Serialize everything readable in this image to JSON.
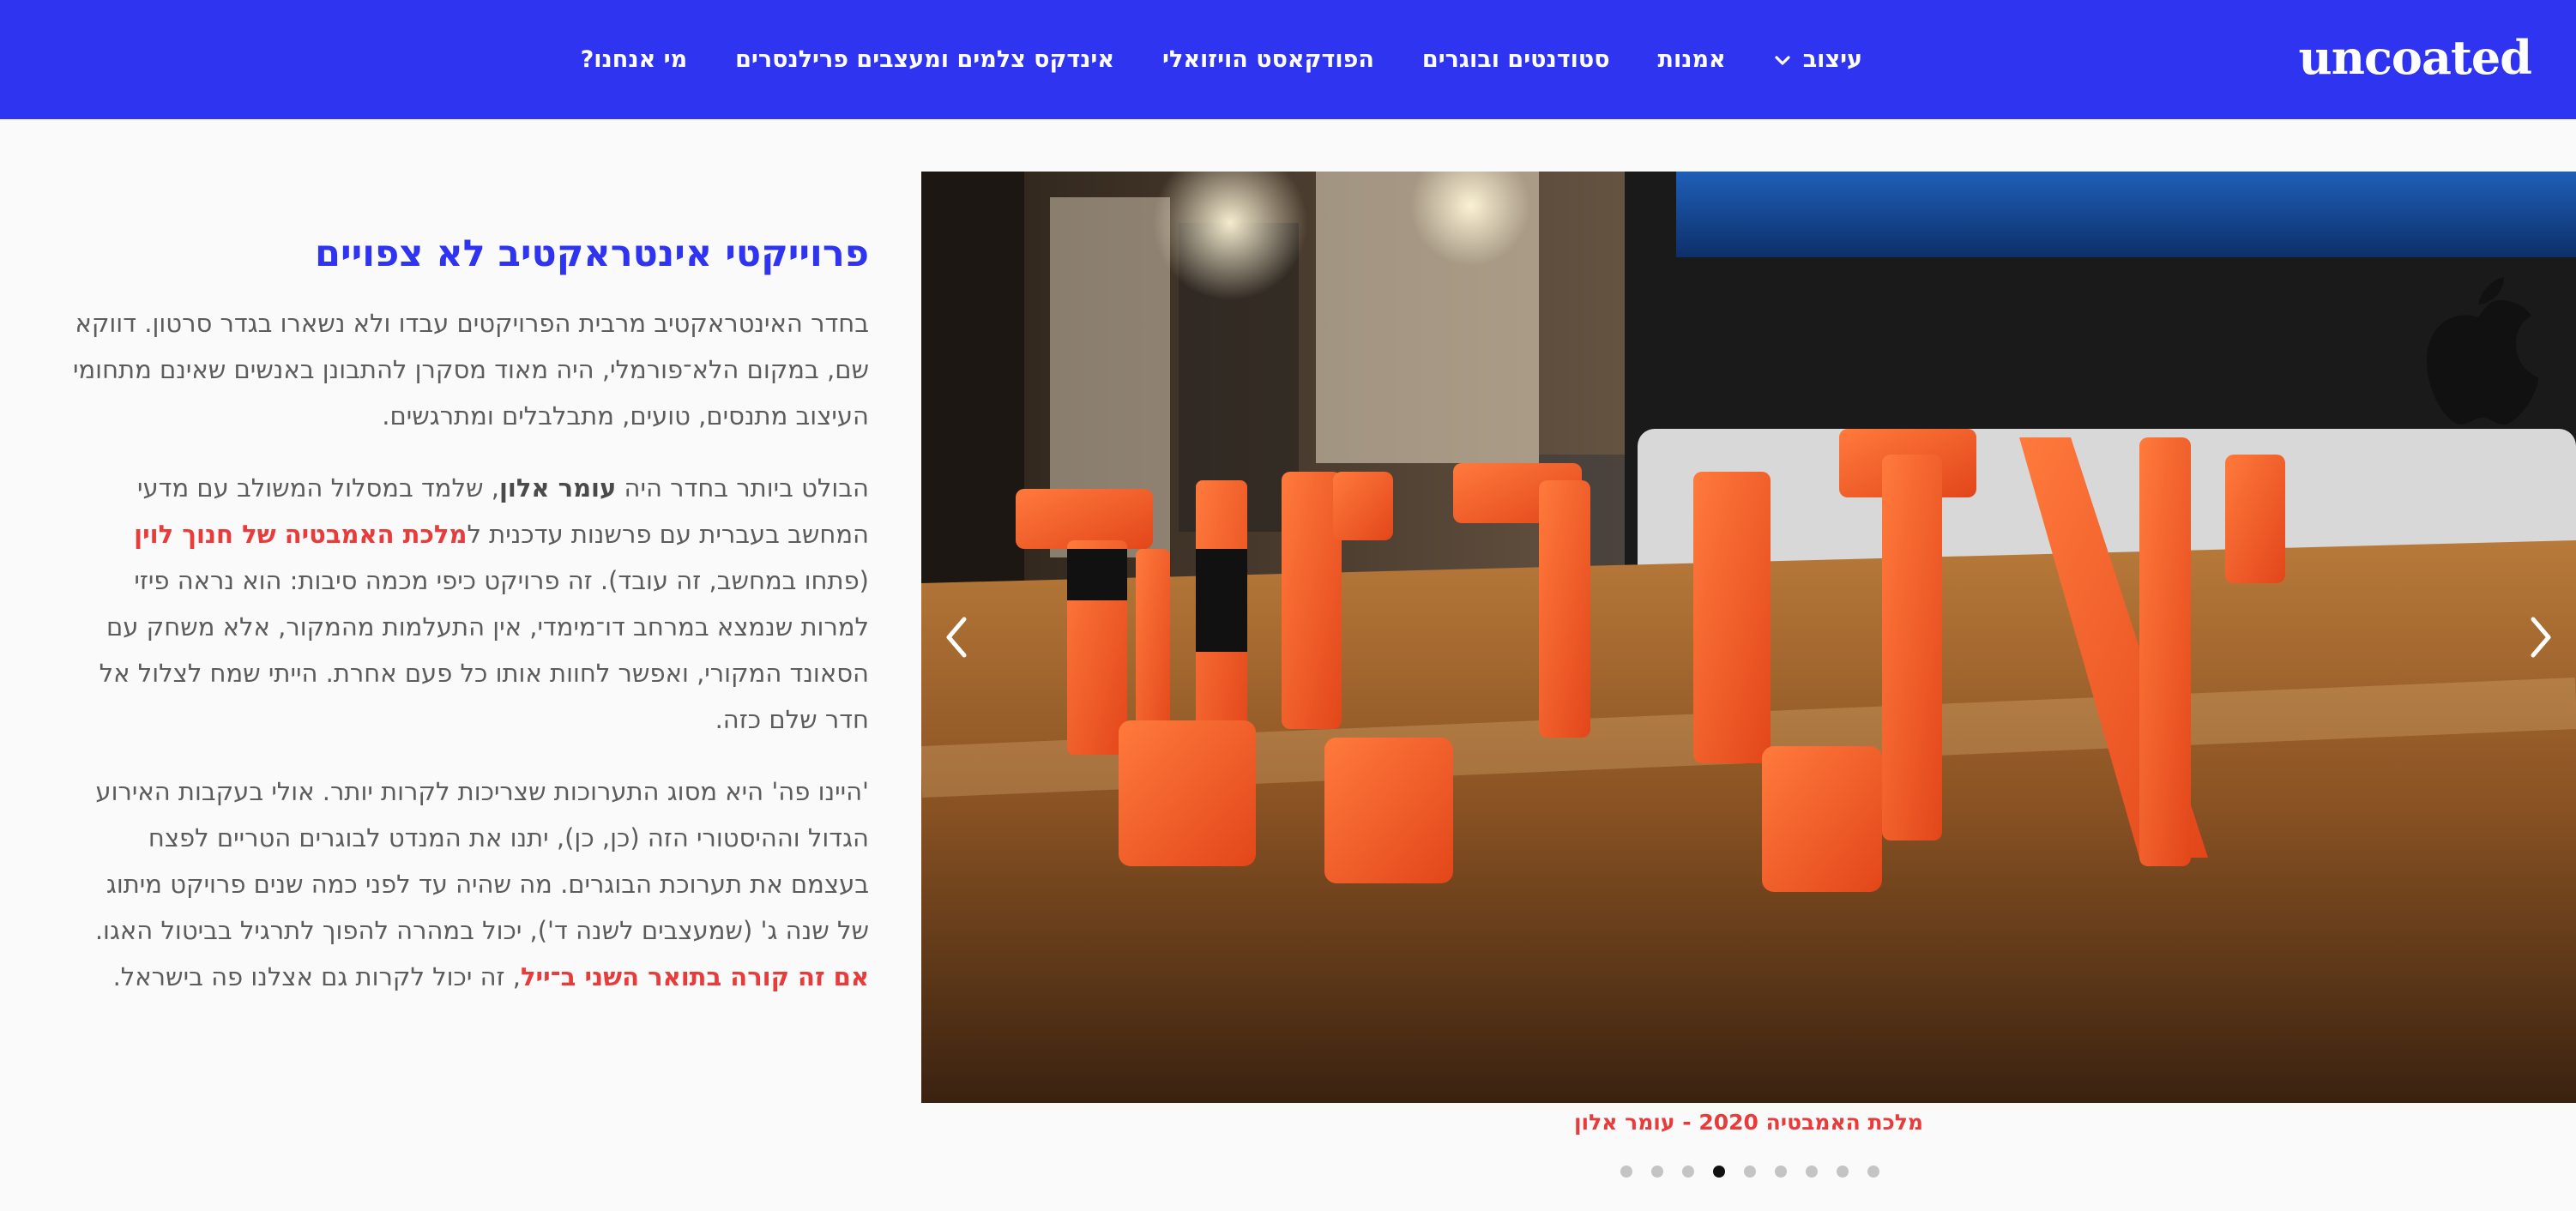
{
  "header": {
    "logo": "uncoated",
    "nav": [
      {
        "label": "עיצוב",
        "has_dropdown": true
      },
      {
        "label": "אמנות"
      },
      {
        "label": "סטודנטים ובוגרים"
      },
      {
        "label": "הפודקאסט הויזואלי"
      },
      {
        "label": "אינדקס צלמים ומעצבים פרילנסרים"
      },
      {
        "label": "מי אנחנו?"
      }
    ],
    "bg_color": "#2f34f0"
  },
  "article": {
    "title": "פרוייקטי אינטראקטיב לא צפויים",
    "p1": "בחדר האינטראקטיב מרבית הפרויקטים עבדו ולא נשארו בגדר סרטון. דווקא שם, במקום הלא־פורמלי, היה מאוד מסקרן להתבונן באנשים שאינם מתחומי העיצוב מתנסים, טועים, מתבלבלים ומתרגשים.",
    "p2": {
      "t1": "הבולט ביותר בחדר היה ",
      "name": "עומר אלון",
      "t2": ", שלמד במסלול המשולב עם מדעי המחשב בעברית עם פרשנות עדכנית ל",
      "link": "מלכת האמבטיה של חנוך לוין",
      "t3": " (פתחו במחשב, זה עובד). זה פרויקט כיפי מכמה סיבות: הוא נראה פיזי למרות שנמצא במרחב דו־מימדי, אין התעלמות מהמקור, אלא משחק עם הסאונד המקורי, ואפשר לחוות אותו כל פעם אחרת. הייתי שמח לצלול אל חדר שלם כזה."
    },
    "p3": {
      "t1": "'היינו פה' היא מסוג התערוכות שצריכות לקרות יותר. אולי בעקבות האירוע הגדול וההיסטורי הזה (כן, כן), יתנו את המנדט לבוגרים הטריים לפצח בעצמם את תערוכת הבוגרים. מה שהיה עד לפני כמה שנים פרויקט מיתוג של שנה ג' (שמעצבים לשנה ד'), יכול במהרה להפוך לתרגיל בביטול האגו. ",
      "link": "אם זה קורה בתואר השני ב־ייל",
      "t2": ", זה יכול לקרות גם אצלנו פה בישראל."
    },
    "accent_color": "#ea3b3b"
  },
  "slider": {
    "caption": "מלכת האמבטיה 2020 - עומר אלון",
    "image": "orange-3d-letters-on-desk-photo",
    "total_slides": 9,
    "active_index": 3
  }
}
